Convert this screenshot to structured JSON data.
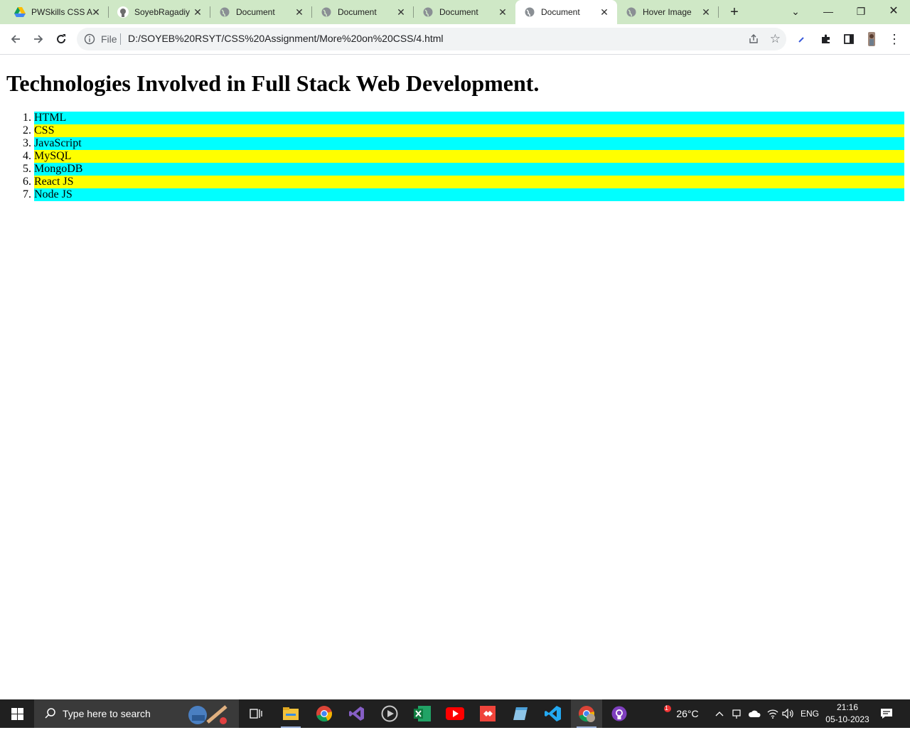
{
  "browser": {
    "tabs": [
      {
        "title": "PWSkills CSS A",
        "icon": "google-drive-icon"
      },
      {
        "title": "SoyebRagadiy",
        "icon": "github-icon"
      },
      {
        "title": "Document",
        "icon": "globe-icon"
      },
      {
        "title": "Document",
        "icon": "globe-icon"
      },
      {
        "title": "Document",
        "icon": "globe-icon"
      },
      {
        "title": "Document",
        "icon": "globe-icon",
        "active": true
      },
      {
        "title": "Hover Image",
        "icon": "globe-icon"
      }
    ],
    "omnibox": {
      "scheme_label": "File",
      "url": "D:/SOYEB%20RSYT/CSS%20Assignment/More%20on%20CSS/4.html"
    }
  },
  "page": {
    "heading": "Technologies Involved in Full Stack Web Development.",
    "list_items": [
      "HTML",
      "CSS",
      "JavaScript",
      "MySQL",
      "MongoDB",
      "React JS",
      "Node JS"
    ],
    "colors": {
      "odd_row": "#00ffff",
      "even_row": "#ffff00"
    }
  },
  "taskbar": {
    "search_placeholder": "Type here to search",
    "weather": {
      "temp": "26°C",
      "badge": "1"
    },
    "language": "ENG",
    "time": "21:16",
    "date": "05-10-2023"
  }
}
